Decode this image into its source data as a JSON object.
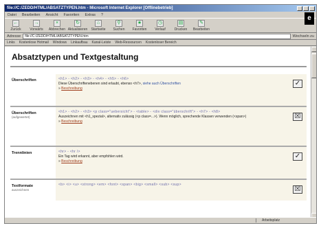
{
  "window": {
    "title": "file://C:/ZEDD/HTML/ABSATZTYPEN.htm - Microsoft Internet Explorer [Offlinebetrieb]"
  },
  "menu": [
    "Datei",
    "Bearbeiten",
    "Ansicht",
    "Favoriten",
    "Extras",
    "?"
  ],
  "toolbar": [
    {
      "label": "Zurück",
      "icon": "back-icon"
    },
    {
      "label": "Vorwärts",
      "icon": "forward-icon"
    },
    {
      "label": "Abbrechen",
      "icon": "stop-icon"
    },
    {
      "label": "Aktualisieren",
      "icon": "refresh-icon"
    },
    {
      "label": "Startseite",
      "icon": "home-icon"
    },
    {
      "label": "Suchen",
      "icon": "search-icon"
    },
    {
      "label": "Favoriten",
      "icon": "favorites-icon"
    },
    {
      "label": "Verlauf",
      "icon": "history-icon"
    },
    {
      "label": "Drucken",
      "icon": "print-icon"
    },
    {
      "label": "Bearbeiten",
      "icon": "edit-icon"
    }
  ],
  "address": {
    "label": "Adresse",
    "value": "file://C:/ZEDD/HTML/ABSATZTYPEN.htm",
    "go_label": "Wechseln zu"
  },
  "links": {
    "label": "Links",
    "items": [
      "Links",
      "Kostenlose Hotmail",
      "Windows",
      "Linkaufbau",
      "Kanal-Leiste",
      "Web-Ressourcen",
      "Kostenloser Bereich"
    ]
  },
  "page": {
    "title": "Absatztypen und Textgestaltung",
    "rows": [
      {
        "label": "Überschriften",
        "sublabel": "",
        "code": "<h1> - <h2> - <h3> - <h4> - <h5> - <h6>",
        "desc": "Diese Überschriftenebenen sind erlaubt, ebenso <h7>, ",
        "link": "siehe auch Überschriften",
        "more": "Beschreibung",
        "check": "✓"
      },
      {
        "label": "Überschriften",
        "sublabel": "(aufgewertet)",
        "code": "<h1> - <h2> - <h3> <p class=\"uebersicht\"> - <table> - <div class=\"überschrift\"> - <h7> - <h8>",
        "desc": "Auszeichnen mit <h1_spezial>, alternativ zulässig (<p class=...>). Wenn möglich, sprechende Klassen verwenden (<span>)",
        "link": "",
        "more": "Beschreibung",
        "check": "☒"
      },
      {
        "label": "Trennlinien",
        "sublabel": "",
        "code": "<hr> - <hr />",
        "desc": "Ein Tag wird erkannt, aber empfohlen wird.",
        "link": "",
        "more": "Beschreibung",
        "check": "✓"
      },
      {
        "label": "Textformate",
        "sublabel": "auszeichnen",
        "code": "<b> <i> <u> <strong> <em> <font> <span> <big> <small> <sub> <sup>",
        "desc": "",
        "link": "",
        "more": "",
        "check": "☒"
      }
    ]
  },
  "status": {
    "left": "",
    "zone": "Arbeitsplatz"
  }
}
